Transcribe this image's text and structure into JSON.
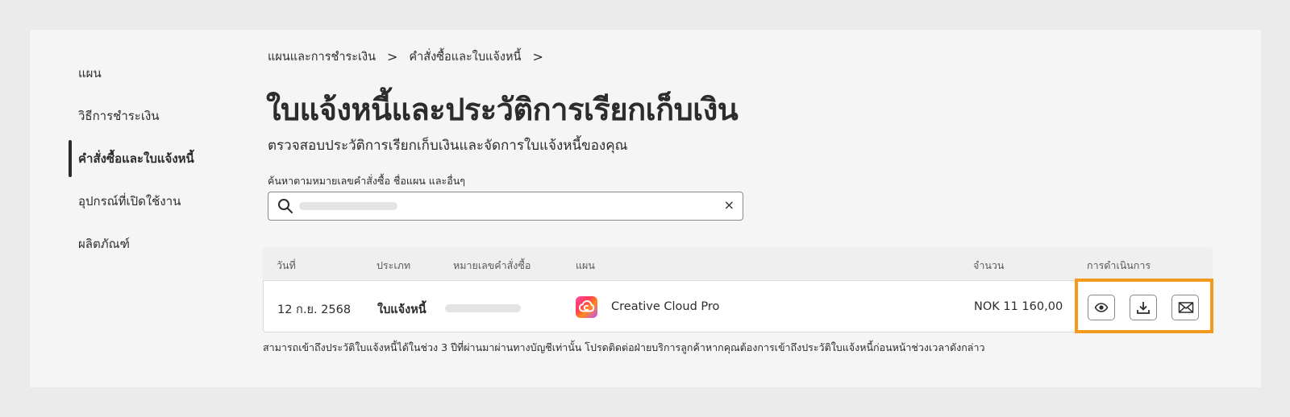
{
  "sidebar": {
    "items": [
      {
        "label": "แผน"
      },
      {
        "label": "วิธีการชำระเงิน"
      },
      {
        "label": "คำสั่งซื้อและใบแจ้งหนี้"
      },
      {
        "label": "อุปกรณ์ที่เปิดใช้งาน"
      },
      {
        "label": "ผลิตภัณฑ์"
      }
    ],
    "active_index": 2
  },
  "breadcrumb": {
    "items": [
      "แผนและการชำระเงิน",
      "คำสั่งซื้อและใบแจ้งหนี้"
    ],
    "separator": ">"
  },
  "page": {
    "title": "ใบแจ้งหนี้และประวัติการเรียกเก็บเงิน",
    "subtitle": "ตรวจสอบประวัติการเรียกเก็บเงินและจัดการใบแจ้งหนี้ของคุณ"
  },
  "search": {
    "label": "ค้นหาตามหมายเลขคำสั่งซื้อ ชื่อแผน และอื่นๆ",
    "value": "",
    "clear": "×"
  },
  "table": {
    "columns": [
      "วันที่",
      "ประเภท",
      "หมายเลขคำสั่งซื้อ",
      "แผน",
      "จำนวน",
      "การดำเนินการ"
    ],
    "rows": [
      {
        "date": "12 ก.ย. 2568",
        "type": "ใบแจ้งหนี้",
        "order_number": "",
        "plan": "Creative Cloud Pro",
        "amount": "NOK 11 160,00",
        "actions": [
          "eye-icon",
          "download-icon",
          "mail-icon"
        ]
      }
    ]
  },
  "footnote": "สามารถเข้าถึงประวัติใบแจ้งหนี้ได้ในช่วง 3 ปีที่ผ่านมาผ่านทางบัญชีเท่านั้น โปรดติดต่อฝ่ายบริการลูกค้าหากคุณต้องการเข้าถึงประวัติใบแจ้งหนี้ก่อนหน้าช่วงเวลาดังกล่าว",
  "colors": {
    "highlight": "#f29a1b",
    "panel": "#f5f5f5",
    "background": "#ebebeb",
    "text": "#2c2c2c"
  }
}
